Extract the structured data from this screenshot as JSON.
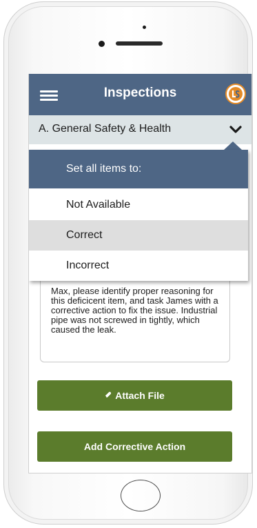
{
  "header": {
    "title": "Inspections"
  },
  "section": {
    "label": "A. General Safety & Health"
  },
  "dropdown": {
    "heading": "Set all items to:",
    "options": [
      {
        "label": "Not Available",
        "selected": false
      },
      {
        "label": "Correct",
        "selected": true
      },
      {
        "label": "Incorrect",
        "selected": false
      }
    ]
  },
  "note": {
    "text": "Max, please identify proper reasoning for this deficicent item, and task James with a corrective action to fix the issue. Industrial pipe was not screwed in tightly, which caused the leak."
  },
  "buttons": {
    "attach_file": "Attach File",
    "add_corrective_action": "Add Corrective Action"
  },
  "icons": {
    "menu": "hamburger-icon",
    "logo": "app-logo-icon",
    "chevron": "chevron-down-icon",
    "attach": "paperclip-icon"
  },
  "colors": {
    "header": "#4e6685",
    "section_bar": "#dde4e6",
    "button_green": "#5b7c2c",
    "selected_row": "#dedede",
    "logo_accent": "#e58b27"
  }
}
